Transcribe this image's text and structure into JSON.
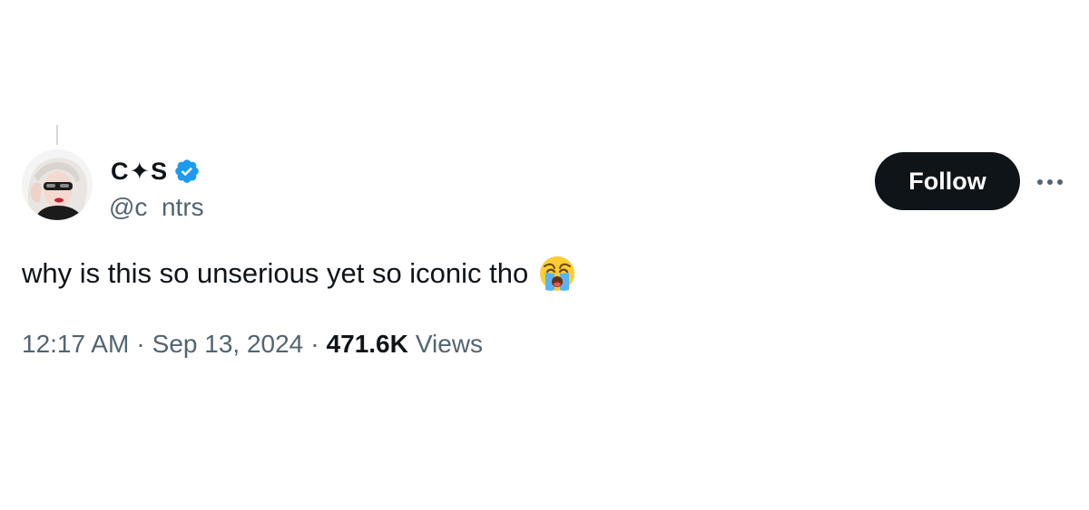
{
  "author": {
    "display_name": "C✦S",
    "handle": "@c  ntrs",
    "verified": true,
    "avatar_icon": "avatar-photo"
  },
  "actions": {
    "follow_label": "Follow",
    "more_icon": "ellipsis-icon"
  },
  "tweet": {
    "text": "why is this so unserious yet so iconic tho",
    "emoji_icon": "loudly-crying-face-icon"
  },
  "meta": {
    "time": "12:17 AM",
    "separator": "·",
    "date": "Sep 13, 2024",
    "views_count": "471.6K",
    "views_label": "Views"
  },
  "colors": {
    "text_primary": "#0f1419",
    "text_secondary": "#536471",
    "verified_blue": "#1d9bf0",
    "follow_bg": "#0f1419",
    "follow_text": "#ffffff"
  }
}
